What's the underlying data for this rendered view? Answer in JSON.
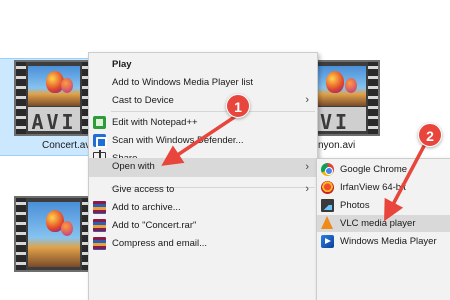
{
  "explorer": {
    "files": [
      {
        "name": "Concert.avi",
        "thumb_text": "AVI",
        "selected": true
      },
      {
        "name": "nyon.avi",
        "thumb_text": "VI",
        "selected": false
      },
      {
        "name": "",
        "thumb_text": "",
        "selected": false
      }
    ]
  },
  "context_menu": {
    "items": [
      {
        "label": "Play",
        "icon": "none",
        "bold": true
      },
      {
        "label": "Add to Windows Media Player list",
        "icon": "none"
      },
      {
        "label": "Cast to Device",
        "icon": "none",
        "submenu": true
      },
      {
        "label": "Edit with Notepad++",
        "icon": "notepad-plus-icon"
      },
      {
        "label": "Scan with Windows Defender...",
        "icon": "defender-icon"
      },
      {
        "label": "Share",
        "icon": "share-icon"
      },
      {
        "label": "Open with",
        "icon": "none",
        "submenu": true,
        "highlighted": true
      },
      {
        "label": "Give access to",
        "icon": "none",
        "submenu": true
      },
      {
        "label": "Add to archive...",
        "icon": "winrar-icon"
      },
      {
        "label": "Add to \"Concert.rar\"",
        "icon": "winrar-icon"
      },
      {
        "label": "Compress and email...",
        "icon": "winrar-icon"
      }
    ]
  },
  "open_with_menu": {
    "items": [
      {
        "label": "Google Chrome",
        "icon": "chrome-icon"
      },
      {
        "label": "IrfanView 64-bit",
        "icon": "irfanview-icon"
      },
      {
        "label": "Photos",
        "icon": "photos-icon"
      },
      {
        "label": "VLC media player",
        "icon": "vlc-icon",
        "highlighted": true
      },
      {
        "label": "Windows Media Player",
        "icon": "wmp-icon"
      }
    ]
  },
  "annotations": {
    "step1": "1",
    "step2": "2",
    "color": "#e8453c"
  }
}
